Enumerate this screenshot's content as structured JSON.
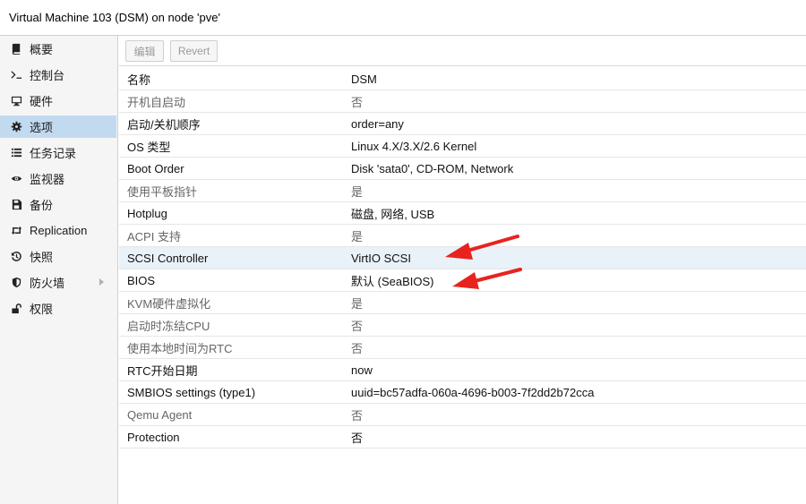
{
  "window": {
    "title": "Virtual Machine 103 (DSM) on node 'pve'"
  },
  "sidebar": {
    "items": [
      {
        "label": "概要",
        "icon": "book-icon"
      },
      {
        "label": "控制台",
        "icon": "terminal-icon"
      },
      {
        "label": "硬件",
        "icon": "monitor-icon"
      },
      {
        "label": "选项",
        "icon": "gear-icon",
        "selected": true
      },
      {
        "label": "任务记录",
        "icon": "list-icon"
      },
      {
        "label": "监视器",
        "icon": "eye-icon"
      },
      {
        "label": "备份",
        "icon": "floppy-icon"
      },
      {
        "label": "Replication",
        "icon": "retweet-icon"
      },
      {
        "label": "快照",
        "icon": "history-icon"
      },
      {
        "label": "防火墙",
        "icon": "shield-icon",
        "has_submenu": true
      },
      {
        "label": "权限",
        "icon": "unlock-icon"
      }
    ]
  },
  "toolbar": {
    "edit_label": "编辑",
    "revert_label": "Revert"
  },
  "options": {
    "rows": [
      {
        "key": "名称",
        "value": "DSM"
      },
      {
        "key": "开机自启动",
        "value": "否"
      },
      {
        "key": "启动/关机顺序",
        "value": "order=any"
      },
      {
        "key": "OS 类型",
        "value": "Linux 4.X/3.X/2.6 Kernel"
      },
      {
        "key": "Boot Order",
        "value": "Disk 'sata0', CD-ROM, Network"
      },
      {
        "key": "使用平板指针",
        "value": "是"
      },
      {
        "key": "Hotplug",
        "value": "磁盘, 网络, USB"
      },
      {
        "key": "ACPI 支持",
        "value": "是"
      },
      {
        "key": "SCSI Controller",
        "value": "VirtIO SCSI"
      },
      {
        "key": "BIOS",
        "value": "默认 (SeaBIOS)"
      },
      {
        "key": "KVM硬件虚拟化",
        "value": "是"
      },
      {
        "key": "启动时冻结CPU",
        "value": "否"
      },
      {
        "key": "使用本地时间为RTC",
        "value": "否"
      },
      {
        "key": "RTC开始日期",
        "value": "now"
      },
      {
        "key": "SMBIOS settings (type1)",
        "value": "uuid=bc57adfa-060a-4696-b003-7f2dd2b72cca"
      },
      {
        "key": "Qemu Agent",
        "value": "否"
      },
      {
        "key": "Protection",
        "value": "否"
      }
    ]
  },
  "colors": {
    "annotation_arrow": "#e8231e",
    "selected_nav": "#c2daf0",
    "highlight_row": "#e9f1f9"
  }
}
